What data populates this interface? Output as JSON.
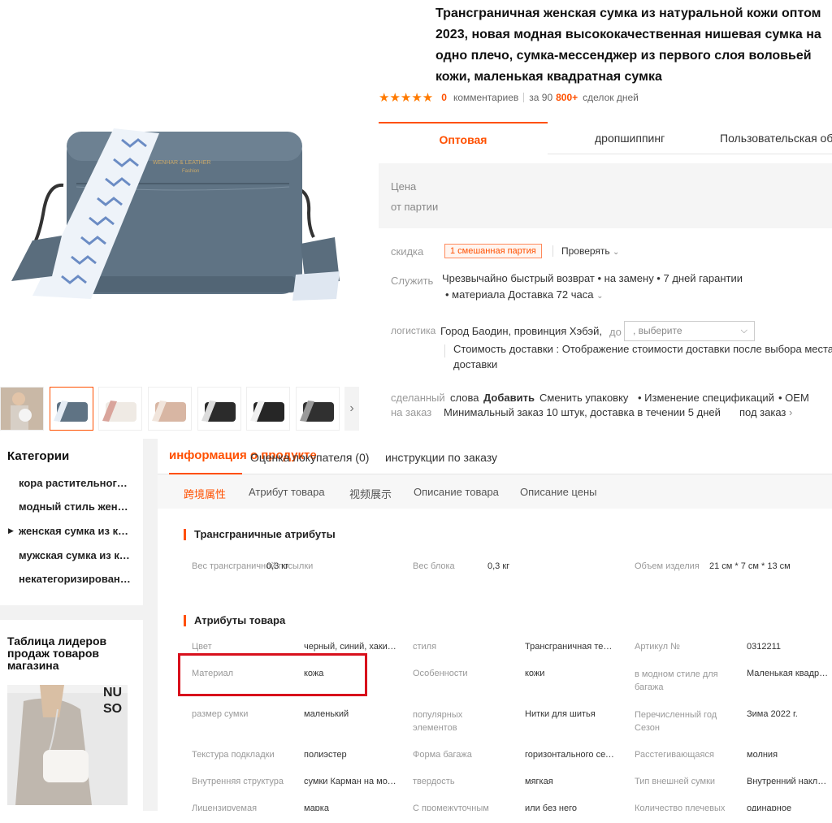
{
  "product": {
    "title_lines": [
      "Трансграничная женская сумка из натуральной кожи оптом",
      "2023, новая модная высококачественная нишевая сумка на",
      "одно плечо, сумка-мессенджер из первого слоя воловьей",
      "кожи, маленькая квадратная сумка"
    ],
    "rating_stars": 5,
    "comments_count": "0",
    "comments_label": "комментариев",
    "deals_prefix": "за 90",
    "deals_count": "800+",
    "deals_suffix": "сделок дней",
    "bag_brand_text": "WENHAR & LEATHER",
    "bag_brand_sub": "Fashion"
  },
  "colors": {
    "accent": "#ff5000",
    "highlight": "#d8101c",
    "star": "#ff7a00",
    "bag": "#5f7384"
  },
  "gallery": {
    "thumbnails": [
      "photo-model",
      "bag-blue",
      "bag-white",
      "bag-pink",
      "bag-black-strap",
      "bag-black",
      "bag-black-pattern"
    ],
    "active_index": 1,
    "next_icon": "chevron-right-icon"
  },
  "top_tabs": [
    "Оптовая",
    "дропшиппинг",
    "Пользовательская обработка"
  ],
  "price": {
    "label": "Цена",
    "sub_label": "от партии"
  },
  "discount": {
    "label": "скидка",
    "badge": "1 смешанная партия",
    "check": "Проверять"
  },
  "service": {
    "label": "Служить",
    "line1": "Чрезвычайно быстрый возврат • на замену • 7 дней гарантии",
    "line2": "• материала Доставка 72 часа"
  },
  "logistics": {
    "label": "логистика",
    "from": "Город Баодин, провинция Хэбэй,",
    "to_label": "до",
    "select_placeholder": ", выберите",
    "cost_line1": "Стоимость доставки : Отображение стоимости доставки после выбора места",
    "cost_line2": "доставки"
  },
  "custom_order": {
    "label_line1": "сделанный",
    "label_line2": "на заказ",
    "word": "слова",
    "add": "Добавить",
    "option1": "Сменить упаковку",
    "option2": "• Изменение спецификаций",
    "option3": "• OEM",
    "min_order": "Минимальный заказ 10 штук, доставка в течении 5 дней",
    "link": "под заказ"
  },
  "sidebar": {
    "categories_title": "Категории",
    "categories": [
      "кора растительного дубления",
      "модный стиль женщины",
      "женская сумка из кожи",
      "мужская сумка из кожи",
      "некатегоризированные"
    ],
    "active_category": 2,
    "leader_title": "Таблица лидеров продаж товаров магазина",
    "leader_img_text": "NU SO"
  },
  "detail_tabs": [
    "информация о продукте",
    "Оценка покупателя (0)",
    "инструкции по заказу"
  ],
  "sub_tabs": [
    "跨境属性",
    "Атрибут товара",
    "视频展示",
    "Описание товара",
    "Описание цены"
  ],
  "cross_border": {
    "title": "Трансграничные атрибуты",
    "items": [
      {
        "k": "Вес трансграничной посылки",
        "v": "0,3 кг"
      },
      {
        "k": "Вес блока",
        "v": "0,3 кг"
      },
      {
        "k": "Объем изделия",
        "v": "21 см * 7 см * 13 см"
      }
    ]
  },
  "attributes": {
    "title": "Атрибуты товара",
    "rows": [
      [
        {
          "k": "Цвет",
          "v": "черный, синий, хаки, розовый"
        },
        {
          "k": "стиля",
          "v": "Трансграничная тенденция"
        },
        {
          "k": "Артикул №",
          "v": "0312211"
        }
      ],
      [
        {
          "k": "Материал",
          "v": "кожа"
        },
        {
          "k": "Особенности",
          "v": "кожи"
        },
        {
          "k": "в модном стиле для багажа",
          "v": "Маленькая квадратная"
        }
      ],
      [
        {
          "k": "размер сумки",
          "v": "маленький"
        },
        {
          "k": "популярных элементов",
          "v": "Нитки для шитья"
        },
        {
          "k": "Перечисленный год Сезон",
          "v": "Зима 2022 г."
        }
      ],
      [
        {
          "k": "Текстура подкладки",
          "v": "полиэстер"
        },
        {
          "k": "Форма багажа",
          "v": "горизонтального сечения"
        },
        {
          "k": "Расстегивающаяся",
          "v": "молния"
        }
      ],
      [
        {
          "k": "Внутренняя структура",
          "v": "сумки Карман на молнии"
        },
        {
          "k": "твердость",
          "v": "мягкая"
        },
        {
          "k": "Тип внешней сумки",
          "v": "Внутренний накладной карман"
        }
      ],
      [
        {
          "k": "Лицензируемая",
          "v": "марка"
        },
        {
          "k": "С промежуточным",
          "v": "или без него"
        },
        {
          "k": "Количество плечевых",
          "v": "одинарное"
        }
      ]
    ]
  }
}
